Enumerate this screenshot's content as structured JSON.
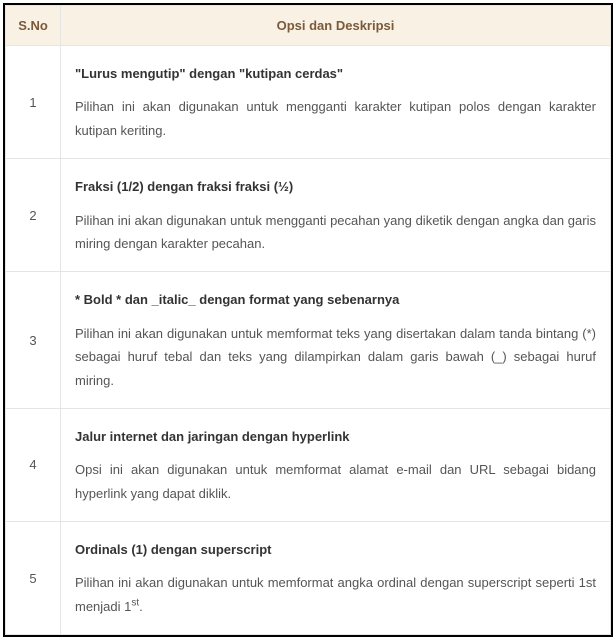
{
  "headers": {
    "sno": "S.No",
    "desc": "Opsi dan Deskripsi"
  },
  "rows": [
    {
      "num": "1",
      "title": "\"Lurus mengutip\" dengan \"kutipan cerdas\"",
      "body": "Pilihan ini akan digunakan untuk mengganti karakter kutipan polos dengan karakter kutipan keriting."
    },
    {
      "num": "2",
      "title": "Fraksi (1/2) dengan fraksi fraksi (½)",
      "body": "Pilihan ini akan digunakan untuk mengganti pecahan yang diketik dengan angka dan garis miring dengan karakter pecahan."
    },
    {
      "num": "3",
      "title": "* Bold * dan _italic_ dengan format yang sebenarnya",
      "body": "Pilihan ini akan digunakan untuk memformat teks yang disertakan dalam tanda bintang (*) sebagai huruf tebal dan teks yang dilampirkan dalam garis bawah (_) sebagai huruf miring."
    },
    {
      "num": "4",
      "title": "Jalur internet dan jaringan dengan hyperlink",
      "body": "Opsi ini akan digunakan untuk memformat alamat e-mail dan URL sebagai bidang hyperlink yang dapat diklik."
    },
    {
      "num": "5",
      "title": "Ordinals (1) dengan superscript",
      "body_prefix": "Pilihan ini akan digunakan untuk memformat angka ordinal dengan superscript seperti 1st menjadi 1",
      "sup": "st",
      "body_suffix": "."
    }
  ]
}
